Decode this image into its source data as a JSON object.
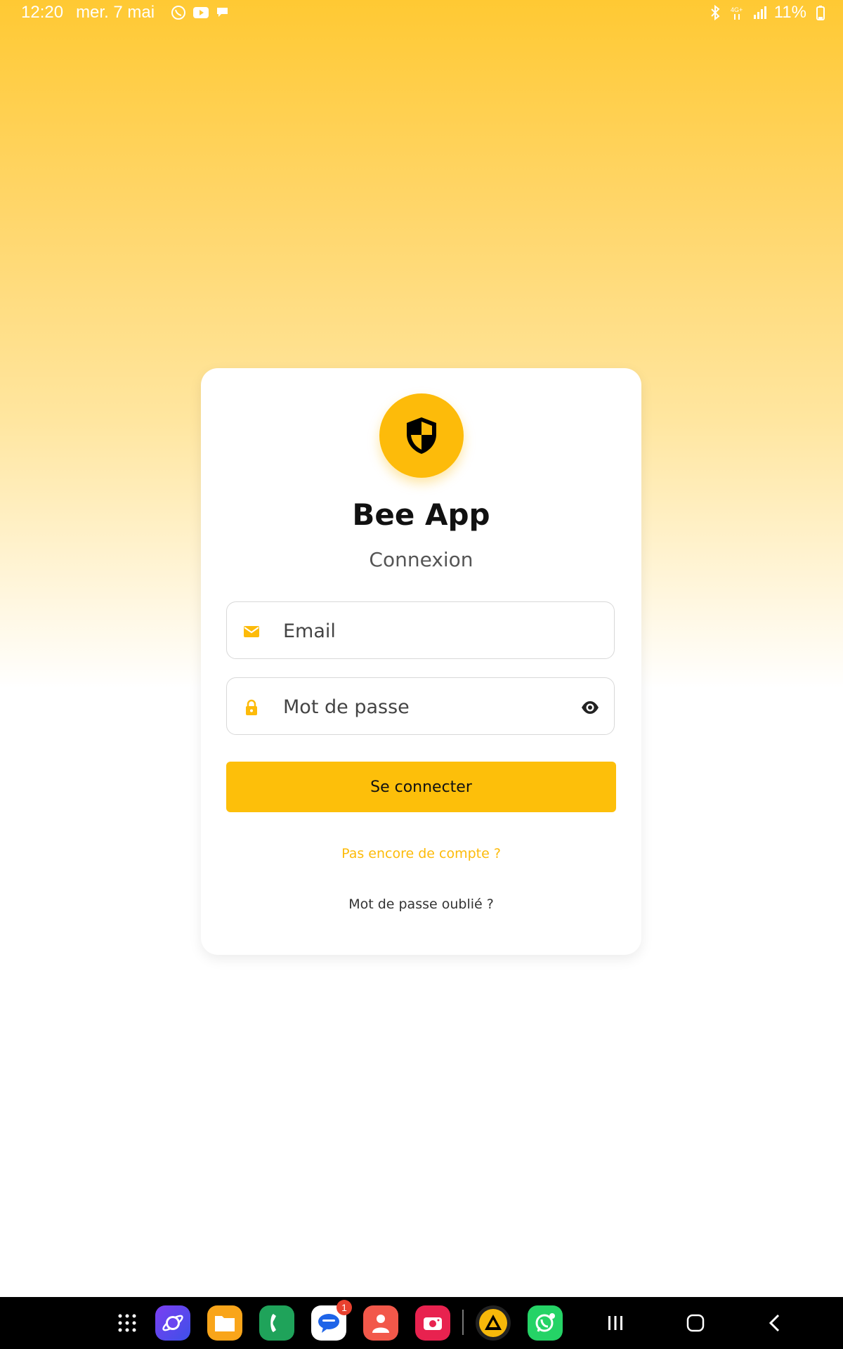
{
  "status_bar": {
    "time": "12:20",
    "date": "mer. 7 mai",
    "battery": "11%",
    "notification_icons": [
      "whatsapp-icon",
      "youtube-icon",
      "chat-icon"
    ],
    "system_icons": [
      "bluetooth-icon",
      "4g-icon",
      "signal-icon",
      "battery-icon"
    ]
  },
  "login": {
    "app_name": "Bee App",
    "subtitle": "Connexion",
    "email_placeholder": "Email",
    "password_placeholder": "Mot de passe",
    "submit_label": "Se connecter",
    "signup_link": "Pas encore de compte ?",
    "forgot_link": "Mot de passe oublié ?"
  },
  "taskbar": {
    "apps": [
      {
        "name": "app-drawer",
        "icon": "grid-icon"
      },
      {
        "name": "internet",
        "icon": "planet-icon"
      },
      {
        "name": "my-files",
        "icon": "folder-icon"
      },
      {
        "name": "phone",
        "icon": "phone-icon"
      },
      {
        "name": "messages",
        "icon": "message-icon",
        "badge": "1"
      },
      {
        "name": "contacts",
        "icon": "person-icon"
      },
      {
        "name": "screen-recorder",
        "icon": "camera-icon"
      },
      {
        "name": "aptoide",
        "icon": "triangle-icon"
      },
      {
        "name": "whatsapp",
        "icon": "whatsapp-icon"
      }
    ],
    "nav": [
      "recents-icon",
      "home-icon",
      "back-icon"
    ]
  },
  "colors": {
    "accent": "#FDBF0A",
    "background_top": "#FFC933",
    "text_dark": "#111111",
    "link_accent": "#FDBB0A"
  }
}
